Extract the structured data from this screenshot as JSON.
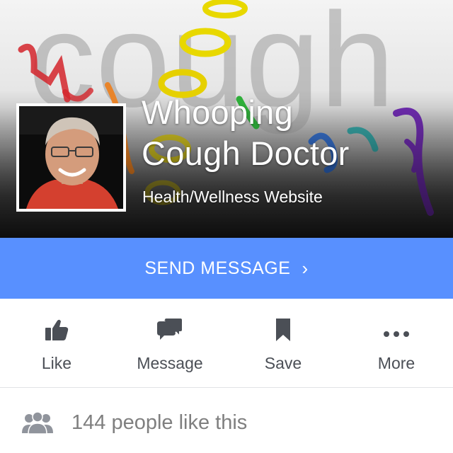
{
  "page": {
    "cover_text": "cough",
    "name_line1": "Whooping",
    "name_line2": "Cough Doctor",
    "category": "Health/Wellness Website"
  },
  "cta": {
    "label": "SEND MESSAGE",
    "chevron": "›"
  },
  "actions": [
    {
      "label": "Like",
      "icon": "thumbs-up-icon"
    },
    {
      "label": "Message",
      "icon": "chat-bubbles-icon"
    },
    {
      "label": "Save",
      "icon": "bookmark-icon"
    },
    {
      "label": "More",
      "icon": "more-dots-icon"
    }
  ],
  "likes": {
    "text": "144 people like this",
    "icon": "people-icon"
  },
  "colors": {
    "cta_background": "#5890ff",
    "icon_gray": "#4b4f56",
    "muted_text": "#7f7f7f"
  }
}
